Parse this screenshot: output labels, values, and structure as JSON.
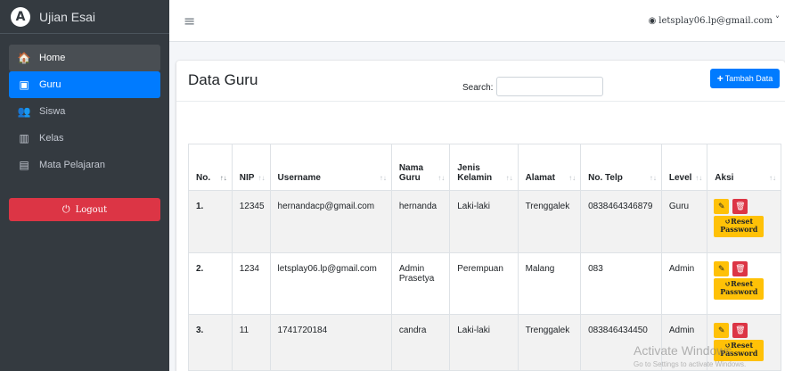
{
  "brand": {
    "logo_letter": "A",
    "title": "Ujian Esai"
  },
  "sidebar": {
    "items": [
      {
        "icon": "home-icon",
        "glyph": "🏠",
        "label": "Home"
      },
      {
        "icon": "chalkboard-icon",
        "glyph": "▣",
        "label": "Guru"
      },
      {
        "icon": "users-icon",
        "glyph": "👥",
        "label": "Siswa"
      },
      {
        "icon": "building-icon",
        "glyph": "▥",
        "label": "Kelas"
      },
      {
        "icon": "book-icon",
        "glyph": "▤",
        "label": "Mata Pelajaran"
      }
    ],
    "logout_label": "Logout"
  },
  "navbar": {
    "user_email": "letsplay06.lp@gmail.com"
  },
  "card": {
    "title": "Data Guru",
    "add_button": "Tambah Data"
  },
  "search": {
    "label": "Search:",
    "value": ""
  },
  "table": {
    "headers": [
      "No.",
      "NIP",
      "Username",
      "Nama Guru",
      "Jenis Kelamin",
      "Alamat",
      "No. Telp",
      "Level",
      "Aksi"
    ],
    "rows": [
      [
        "1.",
        "12345",
        "hernandacp@gmail.com",
        "hernanda",
        "Laki-laki",
        "Trenggalek",
        "0838464346879",
        "Guru"
      ],
      [
        "2.",
        "1234",
        "letsplay06.lp@gmail.com",
        "Admin Prasetya",
        "Perempuan",
        "Malang",
        "083",
        "Admin"
      ],
      [
        "3.",
        "11",
        "1741720184",
        "candra",
        "Laki-laki",
        "Trenggalek",
        "083846434450",
        "Admin"
      ]
    ],
    "reset_label": "Reset Password"
  },
  "watermark": {
    "line1": "Activate Windows",
    "line2": "Go to Settings to activate Windows."
  },
  "colors": {
    "primary": "#007bff",
    "danger": "#dc3545",
    "warning": "#ffc107",
    "sidebar": "#343a40"
  }
}
